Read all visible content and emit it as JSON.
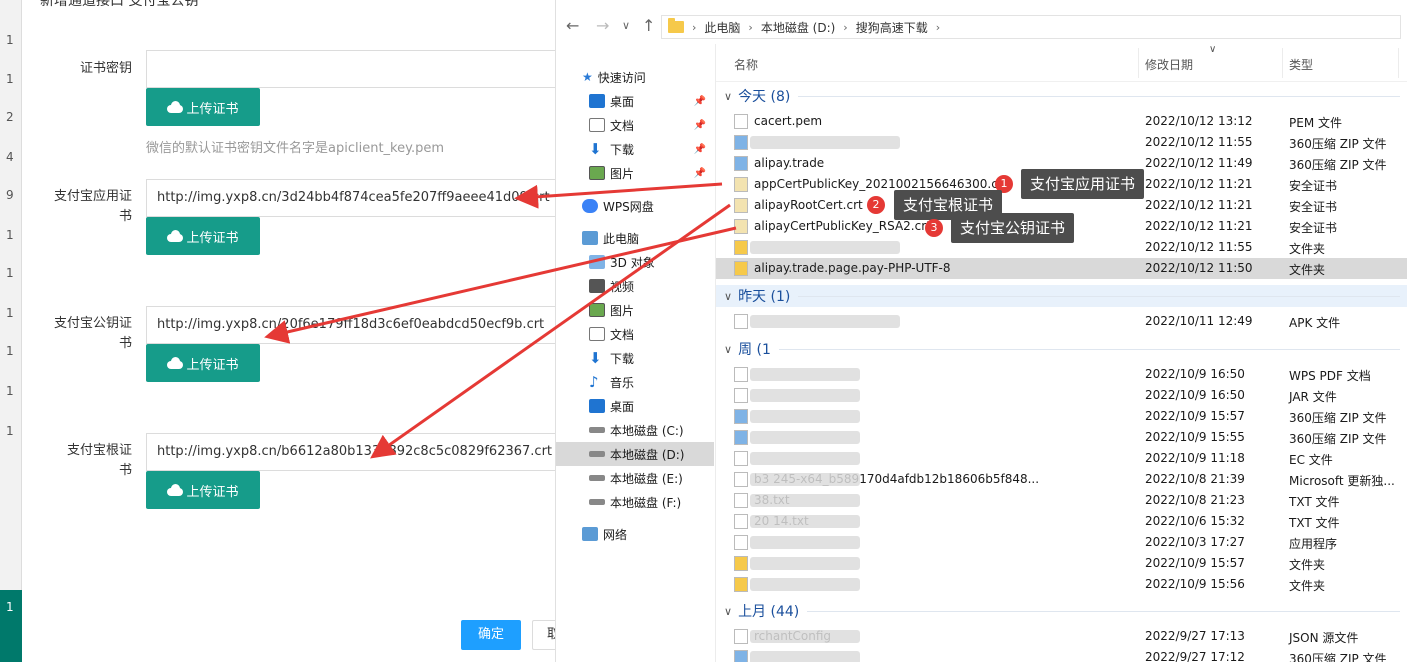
{
  "background_app": {
    "row_numbers": [
      "1",
      "1",
      "2",
      "4",
      "9",
      "1",
      "1",
      "1",
      "1",
      "1",
      "1"
    ],
    "selected_page": "1"
  },
  "dialog": {
    "title": "新增通道接口 支付宝公钥",
    "fields": [
      {
        "label": "证书密钥",
        "value": "",
        "button": "上传证书"
      },
      {
        "label": "支付宝应用证书",
        "value": "http://img.yxp8.cn/3d24bb4f874cea5fe207ff9aeee41d09.crt",
        "button": "上传证书"
      },
      {
        "label": "支付宝公钥证书",
        "value": "http://img.yxp8.cn/20f6e179ff18d3c6ef0eabdcd50ecf9b.crt",
        "button": "上传证书"
      },
      {
        "label": "支付宝根证书",
        "value": "http://img.yxp8.cn/b6612a80b1333892c8c5c0829f62367.crt",
        "button": "上传证书"
      }
    ],
    "hint": "微信的默认证书密钥文件名字是apiclient_key.pem",
    "ok_label": "确定",
    "cancel_label": "取"
  },
  "explorer": {
    "breadcrumb": [
      "此电脑",
      "本地磁盘 (D:)",
      "搜狗高速下载"
    ],
    "nav": {
      "quick_access": "快速访问",
      "pinned": [
        {
          "label": "桌面",
          "icon": "desktop-icon"
        },
        {
          "label": "文档",
          "icon": "document-icon"
        },
        {
          "label": "下载",
          "icon": "download-icon"
        },
        {
          "label": "图片",
          "icon": "picture-icon"
        }
      ],
      "wps": "WPS网盘",
      "this_pc": "此电脑",
      "pc_items": [
        {
          "label": "3D 对象",
          "icon": "3d-icon"
        },
        {
          "label": "视频",
          "icon": "video-icon"
        },
        {
          "label": "图片",
          "icon": "picture-icon"
        },
        {
          "label": "文档",
          "icon": "document-icon"
        },
        {
          "label": "下载",
          "icon": "download-icon"
        },
        {
          "label": "音乐",
          "icon": "music-icon"
        },
        {
          "label": "桌面",
          "icon": "desktop-icon"
        },
        {
          "label": "本地磁盘 (C:)",
          "icon": "drive-icon"
        },
        {
          "label": "本地磁盘 (D:)",
          "icon": "drive-icon"
        },
        {
          "label": "本地磁盘 (E:)",
          "icon": "drive-icon"
        },
        {
          "label": "本地磁盘 (F:)",
          "icon": "drive-icon"
        }
      ],
      "network": "网络"
    },
    "columns": {
      "name": "名称",
      "date": "修改日期",
      "type": "类型"
    },
    "groups": [
      {
        "label": "今天 (8)",
        "files": [
          {
            "name": "cacert.pem",
            "date": "2022/10/12 13:12",
            "type": "PEM 文件"
          },
          {
            "name": "",
            "date": "2022/10/12 11:55",
            "type": "360压缩 ZIP 文件"
          },
          {
            "name": "alipay.trade",
            "date": "2022/10/12 11:49",
            "type": "360压缩 ZIP 文件"
          },
          {
            "name": "appCertPublicKey_2021002156646300.crt",
            "date": "2022/10/12 11:21",
            "type": "安全证书"
          },
          {
            "name": "alipayRootCert.crt",
            "date": "2022/10/12 11:21",
            "type": "安全证书"
          },
          {
            "name": "alipayCertPublicKey_RSA2.crt",
            "date": "2022/10/12 11:21",
            "type": "安全证书"
          },
          {
            "name": "",
            "date": "2022/10/12 11:55",
            "type": "文件夹"
          },
          {
            "name": "alipay.trade.page.pay-PHP-UTF-8",
            "date": "2022/10/12 11:50",
            "type": "文件夹"
          }
        ]
      },
      {
        "label": "昨天 (1)",
        "files": [
          {
            "name": "",
            "date": "2022/10/11 12:49",
            "type": "APK 文件"
          }
        ]
      },
      {
        "label": "周 (1",
        "files": [
          {
            "name": "",
            "date": "2022/10/9 16:50",
            "type": "WPS PDF 文档"
          },
          {
            "name": "",
            "date": "2022/10/9 16:50",
            "type": "JAR 文件"
          },
          {
            "name": "",
            "date": "2022/10/9 15:57",
            "type": "360压缩 ZIP 文件"
          },
          {
            "name": "",
            "date": "2022/10/9 15:55",
            "type": "360压缩 ZIP 文件"
          },
          {
            "name": "",
            "date": "2022/10/9 11:18",
            "type": "EC 文件"
          },
          {
            "name": "b3 245-x64_b589170d4afdb12b18606b5f848...",
            "date": "2022/10/8 21:39",
            "type": "Microsoft 更新独..."
          },
          {
            "name": "38.txt",
            "date": "2022/10/8 21:23",
            "type": "TXT 文件"
          },
          {
            "name": "20 14.txt",
            "date": "2022/10/6 15:32",
            "type": "TXT 文件"
          },
          {
            "name": "",
            "date": "2022/10/3 17:27",
            "type": "应用程序"
          },
          {
            "name": "",
            "date": "2022/10/9 15:57",
            "type": "文件夹"
          },
          {
            "name": "",
            "date": "2022/10/9 15:56",
            "type": "文件夹"
          }
        ]
      },
      {
        "label": "上月 (44)",
        "files": [
          {
            "name": "rchantConfig",
            "date": "2022/9/27 17:13",
            "type": "JSON 源文件"
          },
          {
            "name": "",
            "date": "2022/9/27 17:12",
            "type": "360压缩 ZIP 文件"
          }
        ]
      }
    ]
  },
  "annotations": [
    {
      "num": "1",
      "text": "支付宝应用证书"
    },
    {
      "num": "2",
      "text": "支付宝根证书"
    },
    {
      "num": "3",
      "text": "支付宝公钥证书"
    }
  ],
  "colors": {
    "upload_button": "#169c8a",
    "ok_button": "#1e9fff",
    "arrow": "#e53935",
    "group_text": "#1a4f9c"
  }
}
